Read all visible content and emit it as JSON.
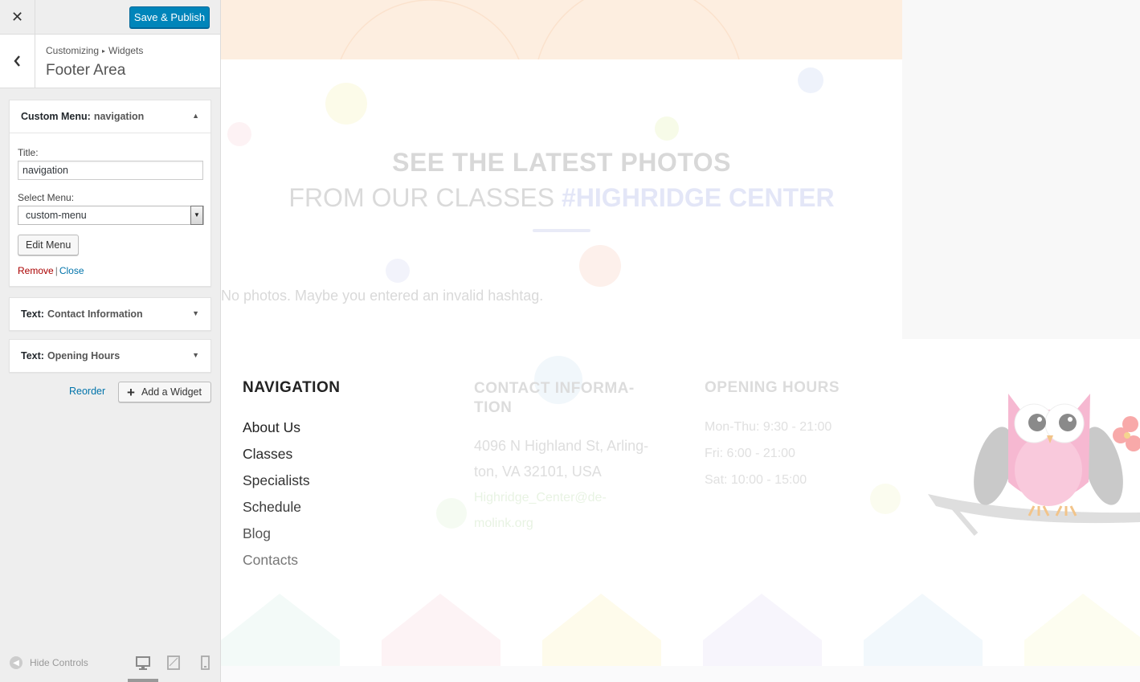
{
  "customizer": {
    "close_label": "✕",
    "publish_label": "Save & Publish",
    "breadcrumb_root": "Customizing",
    "breadcrumb_sep": "▸",
    "breadcrumb_current": "Widgets",
    "section_title": "Footer Area",
    "widgets": [
      {
        "type_label": "Custom Menu:",
        "instance_label": "navigation",
        "expanded": true,
        "title_label": "Title:",
        "title_value": "navigation",
        "select_label": "Select Menu:",
        "select_value": "custom-menu",
        "edit_button": "Edit Menu",
        "remove_label": "Remove",
        "pipe": "|",
        "close_label": "Close"
      },
      {
        "type_label": "Text:",
        "instance_label": "Contact Information",
        "expanded": false
      },
      {
        "type_label": "Text:",
        "instance_label": "Opening Hours",
        "expanded": false
      }
    ],
    "reorder_label": "Reorder",
    "add_widget_label": "Add a Widget",
    "hide_controls_label": "Hide Controls"
  },
  "preview": {
    "photos_heading_line1": "SEE THE LATEST PHOTOS",
    "photos_heading_line2_prefix": "FROM OUR CLASSES ",
    "photos_heading_hashtag": "#HIGHRIDGE CENTER",
    "no_photos_text": "No photos. Maybe you entered an invalid hashtag.",
    "footer": {
      "navigation_title": "NAVIGATION",
      "nav_items": [
        "About Us",
        "Classes",
        "Specialists",
        "Schedule",
        "Blog",
        "Contacts"
      ],
      "contact_title": "CONTACT INFORMA-TION",
      "contact_address": "4096 N Highland St, Arling-ton, VA 32101, USA",
      "contact_email": "Highridge_Center@de-molink.org",
      "hours_title": "OPENING HOURS",
      "hours": [
        "Mon-Thu: 9:30 - 21:00",
        "Fri: 6:00 - 21:00",
        "Sat: 10:00 - 15:00"
      ]
    }
  },
  "colors": {
    "primary_button": "#0085ba",
    "link": "#0073aa",
    "remove_link": "#aa0000",
    "peach_band": "#fdeee0"
  }
}
